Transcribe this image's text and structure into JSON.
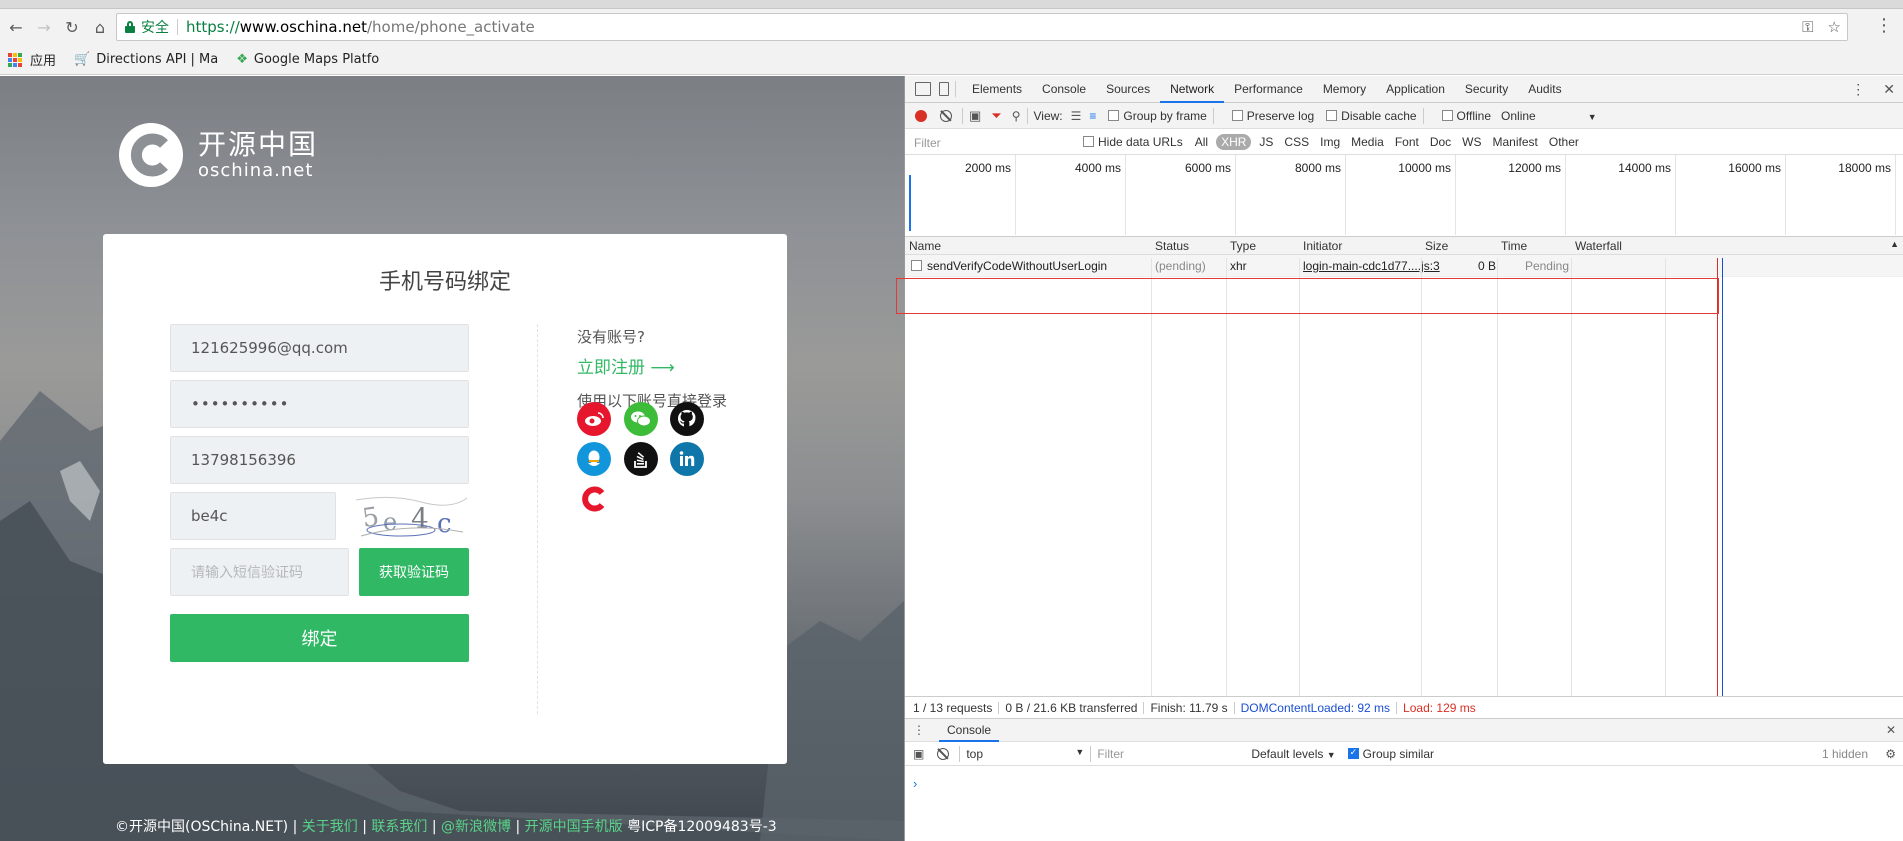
{
  "browser": {
    "secure_label": "安全",
    "url_scheme": "https://",
    "url_host": "www.oschina.net",
    "url_path": "/home/phone_activate",
    "bookmarks": [
      {
        "label": "应用"
      },
      {
        "label": "Directions API | Ma"
      },
      {
        "label": "Google Maps Platfo"
      }
    ]
  },
  "page": {
    "logo_cn": "开源中国",
    "logo_en": "oschina.net",
    "card_title": "手机号码绑定",
    "email_value": "121625996@qq.com",
    "password_value": "••••••••••",
    "phone_value": "13798156396",
    "captcha_value": "be4c",
    "captcha_image_text": "5e4c",
    "sms_placeholder": "请输入短信验证码",
    "sms_button": "获取验证码",
    "bind_button": "绑定",
    "no_account": "没有账号?",
    "register_link": "立即注册 ⟶",
    "third_party_label": "使用以下账号直接登录",
    "footer": {
      "copyright": "©开源中国(OSChina.NET)",
      "about": "关于我们",
      "contact": "联系我们",
      "weibo": "@新浪微博",
      "mobile": "开源中国手机版",
      "icp": "粤ICP备12009483号-3"
    }
  },
  "devtools": {
    "tabs": [
      "Elements",
      "Console",
      "Sources",
      "Network",
      "Performance",
      "Memory",
      "Application",
      "Security",
      "Audits"
    ],
    "active_tab": "Network",
    "toolbar": {
      "view_label": "View:",
      "group_by_frame": "Group by frame",
      "preserve_log": "Preserve log",
      "disable_cache": "Disable cache",
      "offline": "Offline",
      "throttle": "Online"
    },
    "filter": {
      "placeholder": "Filter",
      "hide_data_urls": "Hide data URLs",
      "types": [
        "All",
        "XHR",
        "JS",
        "CSS",
        "Img",
        "Media",
        "Font",
        "Doc",
        "WS",
        "Manifest",
        "Other"
      ],
      "active_type": "XHR"
    },
    "overview_ticks": [
      "2000 ms",
      "4000 ms",
      "6000 ms",
      "8000 ms",
      "10000 ms",
      "12000 ms",
      "14000 ms",
      "16000 ms",
      "18000 ms"
    ],
    "columns": [
      "Name",
      "Status",
      "Type",
      "Initiator",
      "Size",
      "Time",
      "Waterfall"
    ],
    "requests": [
      {
        "name": "sendVerifyCodeWithoutUserLogin",
        "status": "(pending)",
        "type": "xhr",
        "initiator": "login-main-cdc1d77....js:3",
        "size": "0 B",
        "time": "Pending"
      }
    ],
    "summary": {
      "requests": "1 / 13 requests",
      "transferred": "0 B / 21.6 KB transferred",
      "finish": "Finish: 11.79 s",
      "dom_loaded": "DOMContentLoaded: 92 ms",
      "load": "Load: 129 ms"
    },
    "drawer": {
      "tab": "Console",
      "context": "top",
      "filter_placeholder": "Filter",
      "levels": "Default levels",
      "group_similar": "Group similar",
      "hidden": "1 hidden",
      "prompt": "›"
    }
  }
}
